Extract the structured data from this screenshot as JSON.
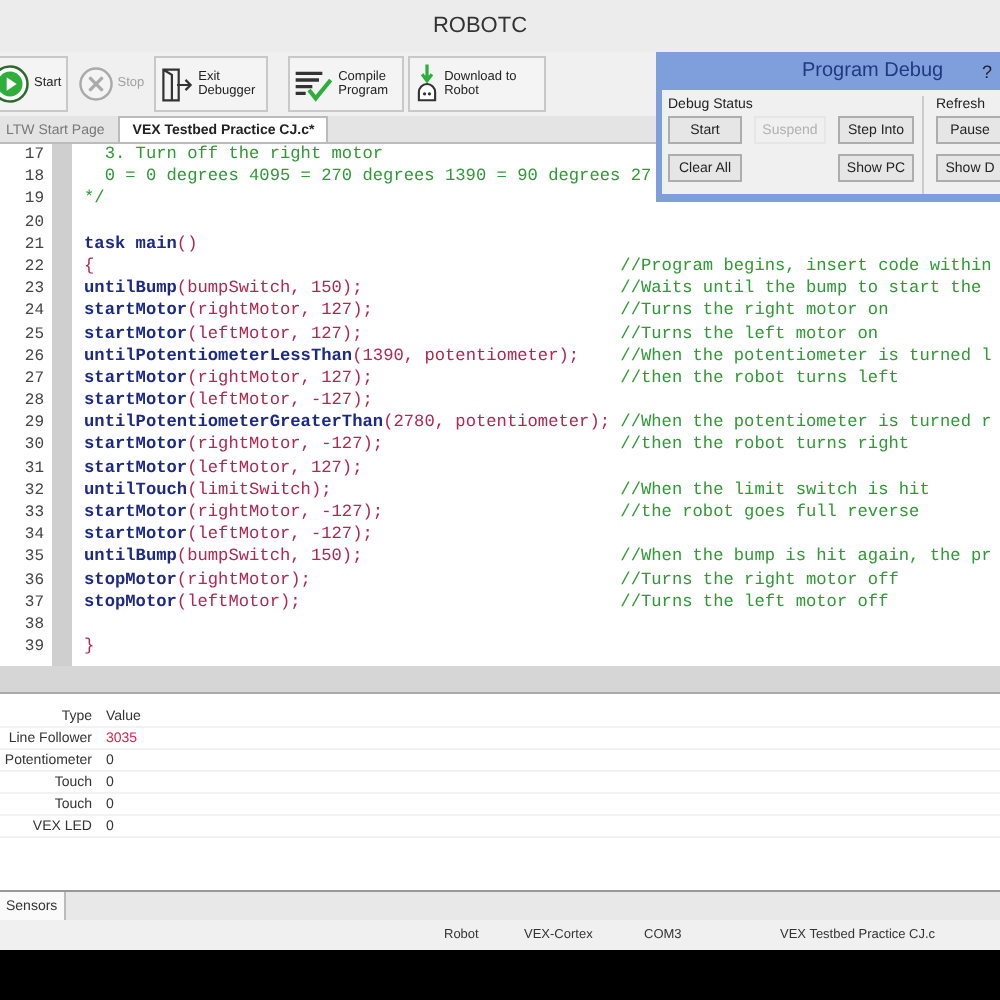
{
  "window": {
    "title": "ROBOTC"
  },
  "toolbar": [
    {
      "kind": "start",
      "label": "Start",
      "disabled": false
    },
    {
      "kind": "stop",
      "label": "Stop",
      "disabled": true
    },
    {
      "kind": "exit",
      "label": "Exit Debugger",
      "disabled": false
    },
    {
      "kind": "compile",
      "label": "Compile Program",
      "disabled": false
    },
    {
      "kind": "download",
      "label": "Download to Robot",
      "disabled": false
    }
  ],
  "tabs": [
    {
      "label": "LTW Start Page",
      "selected": false
    },
    {
      "label": "VEX Testbed Practice CJ.c*",
      "selected": true
    }
  ],
  "code_lines": [
    {
      "number": "17",
      "segments": [
        {
          "kind": "comment",
          "text": "  3. Turn off the right motor"
        }
      ]
    },
    {
      "number": "18",
      "segments": [
        {
          "kind": "comment",
          "text": "  0 = 0 degrees 4095 = 270 degrees 1390 = 90 degrees 27"
        }
      ]
    },
    {
      "number": "19",
      "segments": [
        {
          "kind": "comment",
          "text": "*/"
        }
      ]
    },
    {
      "number": "20"
    },
    {
      "number": "21",
      "segments": [
        {
          "kind": "keyword",
          "text": "task main"
        },
        {
          "kind": "punct",
          "text": "()"
        }
      ]
    },
    {
      "number": "22",
      "segments": [
        {
          "kind": "punct",
          "text": "{"
        }
      ],
      "comment": "//Program begins, insert code within"
    },
    {
      "number": "23",
      "segments": [
        {
          "kind": "keyword",
          "text": "untilBump"
        },
        {
          "kind": "punct",
          "text": "(bumpSwitch, 150);"
        }
      ],
      "comment": "//Waits until the bump to start the"
    },
    {
      "number": "24",
      "segments": [
        {
          "kind": "keyword",
          "text": "startMotor"
        },
        {
          "kind": "punct",
          "text": "(rightMotor, 127);"
        }
      ],
      "comment": "//Turns the right motor on"
    },
    {
      "number": "25",
      "segments": [
        {
          "kind": "keyword",
          "text": "startMotor"
        },
        {
          "kind": "punct",
          "text": "(leftMotor, 127);"
        }
      ],
      "comment": "//Turns the left motor on"
    },
    {
      "number": "26",
      "segments": [
        {
          "kind": "keyword",
          "text": "untilPotentiometerLessThan"
        },
        {
          "kind": "punct",
          "text": "(1390, potentiometer);"
        }
      ],
      "comment": "//When the potentiometer is turned l"
    },
    {
      "number": "27",
      "segments": [
        {
          "kind": "keyword",
          "text": "startMotor"
        },
        {
          "kind": "punct",
          "text": "(rightMotor, 127);"
        }
      ],
      "comment": "//then the robot turns left"
    },
    {
      "number": "28",
      "segments": [
        {
          "kind": "keyword",
          "text": "startMotor"
        },
        {
          "kind": "punct",
          "text": "(leftMotor, -127);"
        }
      ]
    },
    {
      "number": "29",
      "segments": [
        {
          "kind": "keyword",
          "text": "untilPotentiometerGreaterThan"
        },
        {
          "kind": "punct",
          "text": "(2780, potentiometer);"
        }
      ],
      "comment": "//When the potentiometer is turned r"
    },
    {
      "number": "30",
      "segments": [
        {
          "kind": "keyword",
          "text": "startMotor"
        },
        {
          "kind": "punct",
          "text": "(rightMotor, -127);"
        }
      ],
      "comment": "//then the robot turns right"
    },
    {
      "number": "31",
      "segments": [
        {
          "kind": "keyword",
          "text": "startMotor"
        },
        {
          "kind": "punct",
          "text": "(leftMotor, 127);"
        }
      ]
    },
    {
      "number": "32",
      "segments": [
        {
          "kind": "keyword",
          "text": "untilTouch"
        },
        {
          "kind": "punct",
          "text": "(limitSwitch);"
        }
      ],
      "comment": "//When the limit switch is hit"
    },
    {
      "number": "33",
      "segments": [
        {
          "kind": "keyword",
          "text": "startMotor"
        },
        {
          "kind": "punct",
          "text": "(rightMotor, -127);"
        }
      ],
      "comment": "//the robot goes full reverse"
    },
    {
      "number": "34",
      "segments": [
        {
          "kind": "keyword",
          "text": "startMotor"
        },
        {
          "kind": "punct",
          "text": "(leftMotor, -127);"
        }
      ]
    },
    {
      "number": "35",
      "segments": [
        {
          "kind": "keyword",
          "text": "untilBump"
        },
        {
          "kind": "punct",
          "text": "(bumpSwitch, 150);"
        }
      ],
      "comment": "//When the bump is hit again, the pr"
    },
    {
      "number": "36",
      "segments": [
        {
          "kind": "keyword",
          "text": "stopMotor"
        },
        {
          "kind": "punct",
          "text": "(rightMotor);"
        }
      ],
      "comment": "//Turns the right motor off"
    },
    {
      "number": "37",
      "segments": [
        {
          "kind": "keyword",
          "text": "stopMotor"
        },
        {
          "kind": "punct",
          "text": "(leftMotor);"
        }
      ],
      "comment": "//Turns the left motor off"
    },
    {
      "number": "38"
    },
    {
      "number": "39",
      "segments": [
        {
          "kind": "punct",
          "text": "}"
        }
      ]
    }
  ],
  "debug_window": {
    "title": "Program Debug",
    "help": "?",
    "debug_status": {
      "label": "Debug Status",
      "buttons": [
        {
          "label": "Start",
          "disabled": false
        },
        {
          "label": "Suspend",
          "disabled": true
        },
        {
          "label": "Step Into",
          "disabled": false
        },
        {
          "label": "Clear All",
          "disabled": false
        },
        {
          "label": "Show PC",
          "disabled": false
        }
      ]
    },
    "refresh": {
      "label": "Refresh",
      "buttons": [
        {
          "label": "Pause",
          "disabled": false
        },
        {
          "label": "Show D",
          "disabled": false
        }
      ]
    }
  },
  "sensors": {
    "columns": [
      "Type",
      "Value"
    ],
    "rows": [
      {
        "type": "Line Follower",
        "value": "3035",
        "changed": true
      },
      {
        "type": "Potentiometer",
        "value": "0",
        "changed": false
      },
      {
        "type": "Touch",
        "value": "0",
        "changed": false
      },
      {
        "type": "Touch",
        "value": "0",
        "changed": false
      },
      {
        "type": "VEX LED",
        "value": "0",
        "changed": false
      }
    ]
  },
  "bottom_tabs": [
    {
      "label": "Sensors",
      "selected": true
    }
  ],
  "status_bar": [
    "Robot",
    "VEX-Cortex",
    "COM3",
    "VEX Testbed Practice CJ.c"
  ]
}
